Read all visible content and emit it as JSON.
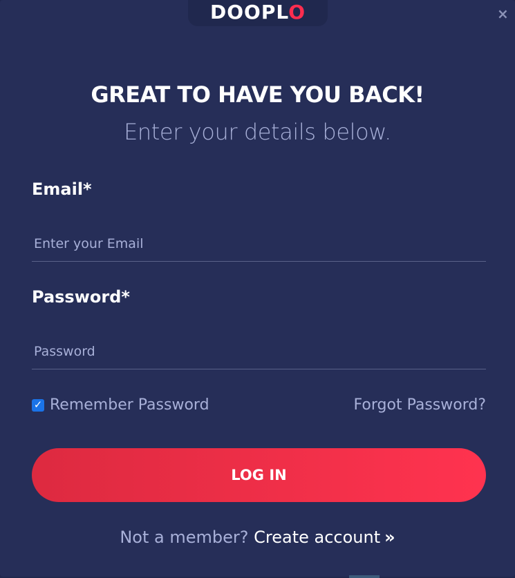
{
  "brand": {
    "logo_main": "DOOPL",
    "logo_accent": "O",
    "accent_color": "#ff2d4f"
  },
  "dialog": {
    "close_icon": "close-icon",
    "heading": "GREAT TO HAVE YOU BACK!",
    "subheading": "Enter your details below."
  },
  "form": {
    "email": {
      "label": "Email*",
      "placeholder": "Enter your Email",
      "value": ""
    },
    "password": {
      "label": "Password*",
      "placeholder": "Password",
      "value": ""
    },
    "remember": {
      "label": "Remember Password",
      "checked": true
    },
    "forgot_label": "Forgot Password?",
    "submit_label": "LOG IN"
  },
  "footer": {
    "prompt": "Not a member?",
    "link": "Create account",
    "chevron": "»"
  }
}
